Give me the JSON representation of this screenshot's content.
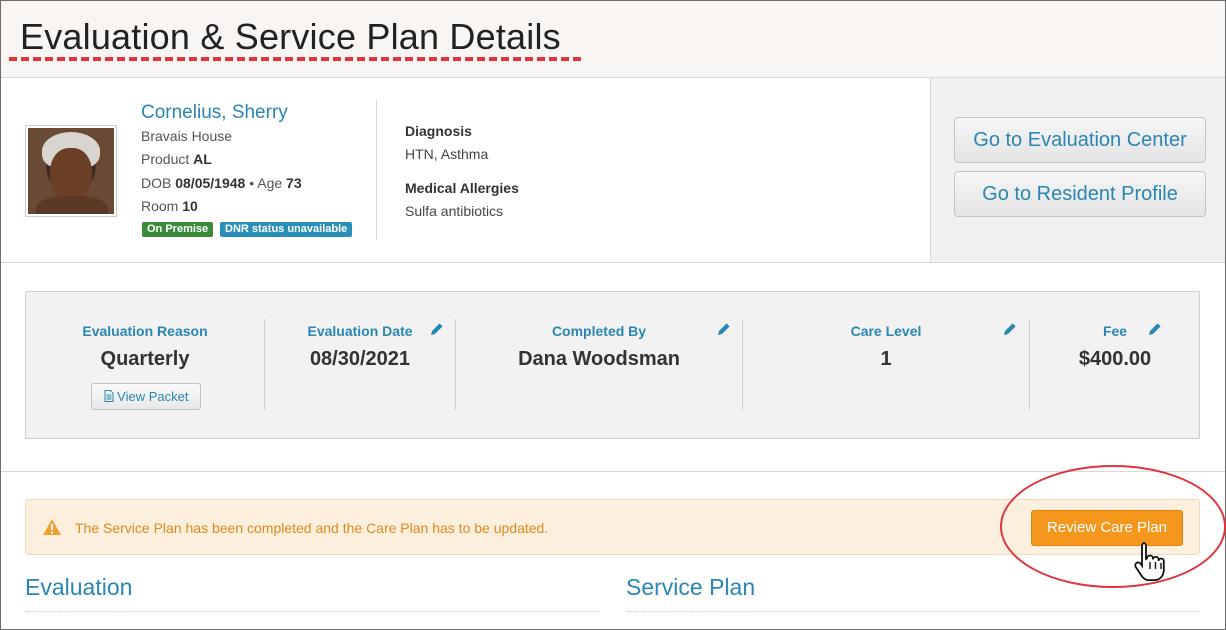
{
  "page": {
    "title": "Evaluation & Service Plan Details"
  },
  "resident": {
    "name": "Cornelius, Sherry",
    "facility": "Bravais House",
    "product_label": "Product",
    "product_value": "AL",
    "dob_label": "DOB",
    "dob_value": "08/05/1948",
    "age_label": "Age",
    "age_value": "73",
    "room_label": "Room",
    "room_value": "10",
    "badges": {
      "on_premise": "On Premise",
      "dnr": "DNR status unavailable"
    },
    "badge_colors": {
      "on_premise": "#3a8a3a",
      "dnr": "#2a8fb8"
    }
  },
  "medical": {
    "diagnosis_label": "Diagnosis",
    "diagnosis_value": "HTN, Asthma",
    "allergies_label": "Medical Allergies",
    "allergies_value": "Sulfa antibiotics"
  },
  "actions": {
    "evaluation_center": "Go to Evaluation Center",
    "resident_profile": "Go to Resident Profile"
  },
  "evaluation": {
    "reason_label": "Evaluation Reason",
    "reason_value": "Quarterly",
    "view_packet": "View Packet",
    "date_label": "Evaluation Date",
    "date_value": "08/30/2021",
    "completed_by_label": "Completed By",
    "completed_by_value": "Dana Woodsman",
    "care_level_label": "Care Level",
    "care_level_value": "1",
    "fee_label": "Fee",
    "fee_value": "$400.00"
  },
  "alert": {
    "message": "The Service Plan has been completed and the Care Plan has to be updated.",
    "button": "Review Care Plan",
    "color": "#e08a1e",
    "button_color": "#f5961d"
  },
  "sections": {
    "evaluation": "Evaluation",
    "service_plan": "Service Plan"
  },
  "icons": {
    "edit": "pencil-icon",
    "warning": "warning-icon",
    "document": "document-icon",
    "cursor": "hand-cursor-icon"
  },
  "colors": {
    "accent": "#2a86b3",
    "highlight": "#e0343f"
  }
}
